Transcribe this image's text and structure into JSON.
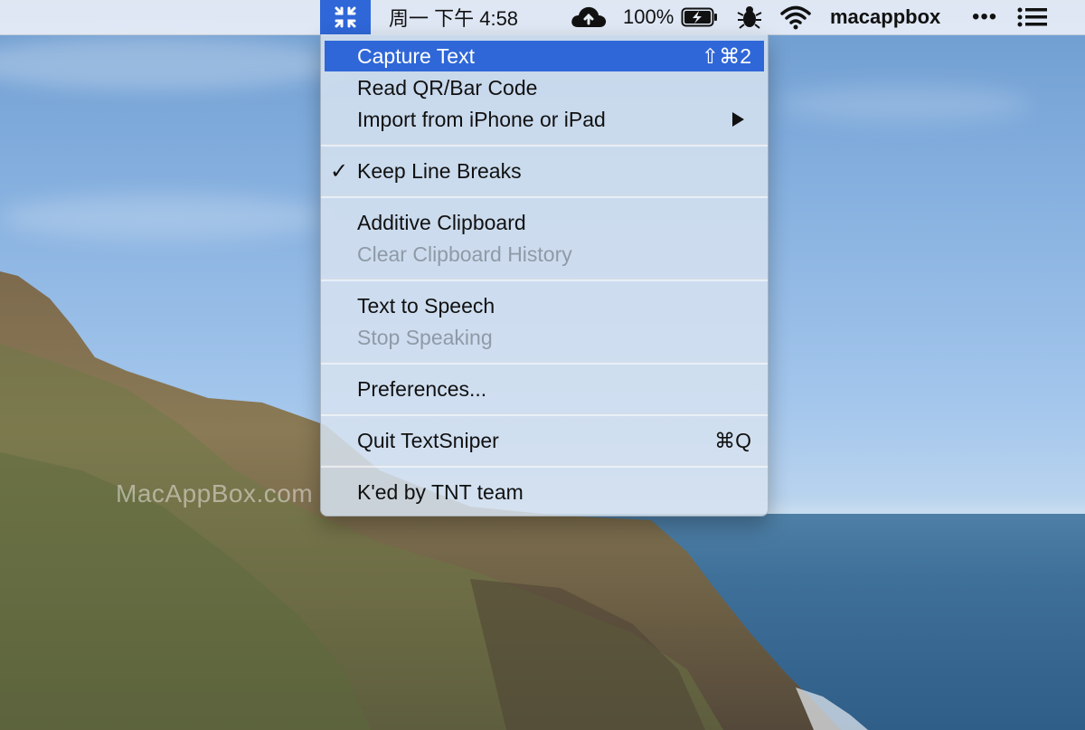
{
  "menubar": {
    "clock": "周一 下午 4:58",
    "battery_pct": "100%",
    "username": "macappbox",
    "more": "•••"
  },
  "menu": {
    "capture_text": {
      "label": "Capture Text",
      "shortcut": "⇧⌘2"
    },
    "read_qr": {
      "label": "Read QR/Bar Code"
    },
    "import_iphone": {
      "label": "Import from iPhone or iPad"
    },
    "keep_line_breaks": {
      "label": "Keep Line Breaks",
      "check": "✓"
    },
    "additive_clipboard": {
      "label": "Additive Clipboard"
    },
    "clear_clipboard": {
      "label": "Clear Clipboard History"
    },
    "text_to_speech": {
      "label": "Text to Speech"
    },
    "stop_speaking": {
      "label": "Stop Speaking"
    },
    "preferences": {
      "label": "Preferences..."
    },
    "quit": {
      "label": "Quit TextSniper",
      "shortcut": "⌘Q"
    },
    "tnt": {
      "label": "K'ed by TNT team"
    }
  },
  "watermark": "MacAppBox.com",
  "colors": {
    "highlight": "#2f67d8",
    "menu_bg": "#d6e2f0",
    "disabled_text": "#8f9aa7"
  },
  "icons": [
    "textsniper-icon",
    "icloud-icon",
    "battery-charging-icon",
    "bug-icon",
    "wifi-icon",
    "list-icon"
  ]
}
